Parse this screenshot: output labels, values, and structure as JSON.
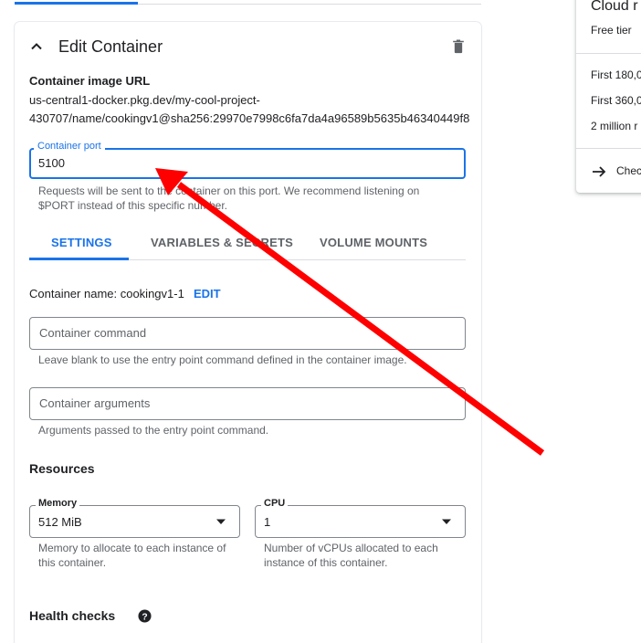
{
  "card": {
    "title": "Edit Container",
    "image_label": "Container image URL",
    "image_url": "us-central1-docker.pkg.dev/my-cool-project-\n430707/name/cookingv1@sha256:29970e7998c6fa7da4a96589b5635b46340449f8"
  },
  "port": {
    "label": "Container port",
    "value": "5100",
    "help": "Requests will be sent to the container on this port. We recommend listening on $PORT instead of this specific number."
  },
  "tabs": [
    {
      "label": "SETTINGS",
      "active": true
    },
    {
      "label": "VARIABLES & SECRETS",
      "active": false
    },
    {
      "label": "VOLUME MOUNTS",
      "active": false
    }
  ],
  "container_name": {
    "text": "Container name: cookingv1-1",
    "edit_label": "EDIT"
  },
  "command": {
    "placeholder": "Container command",
    "help": "Leave blank to use the entry point command defined in the container image."
  },
  "arguments": {
    "placeholder": "Container arguments",
    "help": "Arguments passed to the entry point command."
  },
  "resources": {
    "title": "Resources",
    "memory": {
      "label": "Memory",
      "value": "512 MiB",
      "help": "Memory to allocate to each instance of this container."
    },
    "cpu": {
      "label": "CPU",
      "value": "1",
      "help": "Number of vCPUs allocated to each instance of this container."
    }
  },
  "health": {
    "title": "Health checks"
  },
  "pricing": {
    "title": "Cloud r",
    "free_tier": "Free tier",
    "lines": [
      "First 180,0",
      "First 360,0",
      "2 million r"
    ],
    "link": "Chec"
  },
  "colors": {
    "accent": "#1a73e8",
    "annotation": "#ff0000",
    "text": "#202124",
    "muted": "#5f6368"
  },
  "icons": {
    "collapse": "chevron-up-icon",
    "delete": "trash-icon",
    "dropdown": "caret-down-icon",
    "help": "help-circle-icon",
    "link": "arrow-right-icon"
  }
}
